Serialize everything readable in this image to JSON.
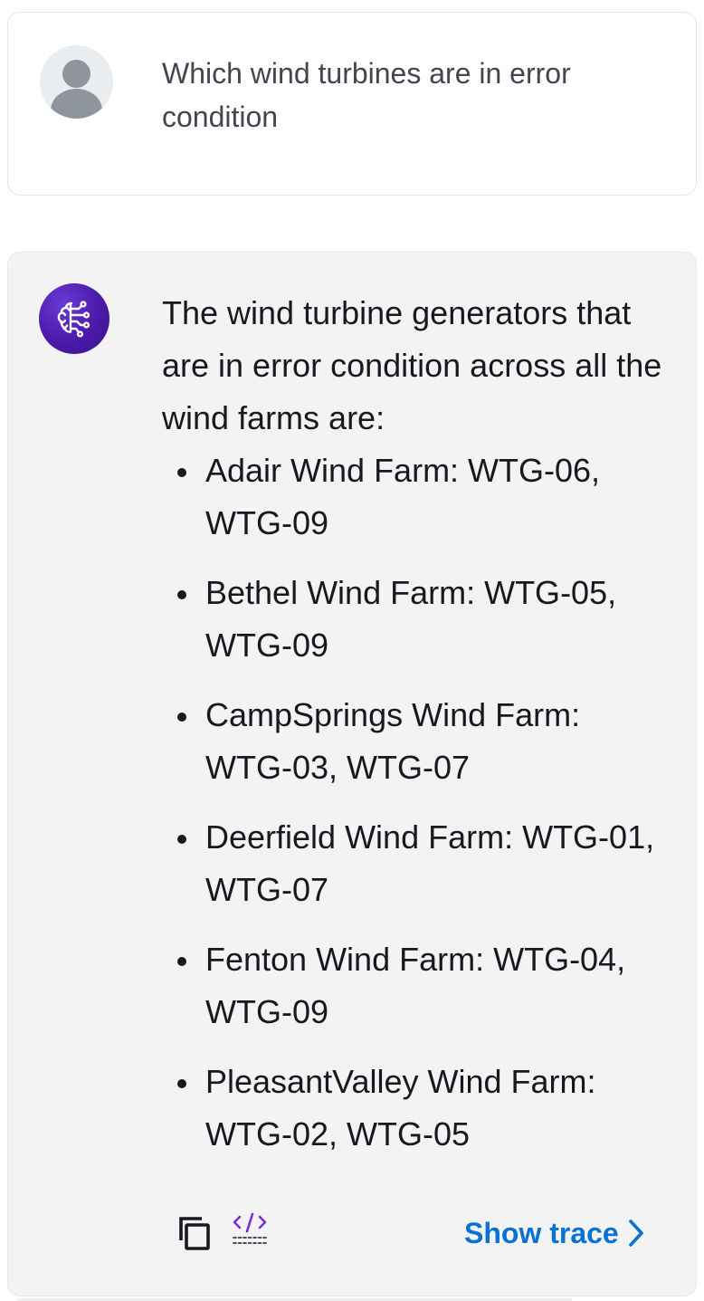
{
  "user_message": {
    "text": "Which wind turbines are in error condition"
  },
  "assistant_message": {
    "intro": "The wind turbine generators that are in error condition across all the wind farms are:",
    "items": [
      "Adair Wind Farm: WTG-06, WTG-09",
      "Bethel Wind Farm: WTG-05, WTG-09",
      "CampSprings Wind Farm: WTG-03, WTG-07",
      "Deerfield Wind Farm: WTG-01, WTG-07",
      "Fenton Wind Farm: WTG-04, WTG-09",
      "PleasantValley Wind Farm: WTG-02, WTG-05"
    ]
  },
  "actions": {
    "copy_icon": "copy-icon",
    "code_icon": "code-icon",
    "show_trace_label": "Show trace"
  },
  "colors": {
    "accent": "#0972d3",
    "assistant_avatar": "#4b1aa8",
    "code_icon": "#7b2fd8"
  }
}
